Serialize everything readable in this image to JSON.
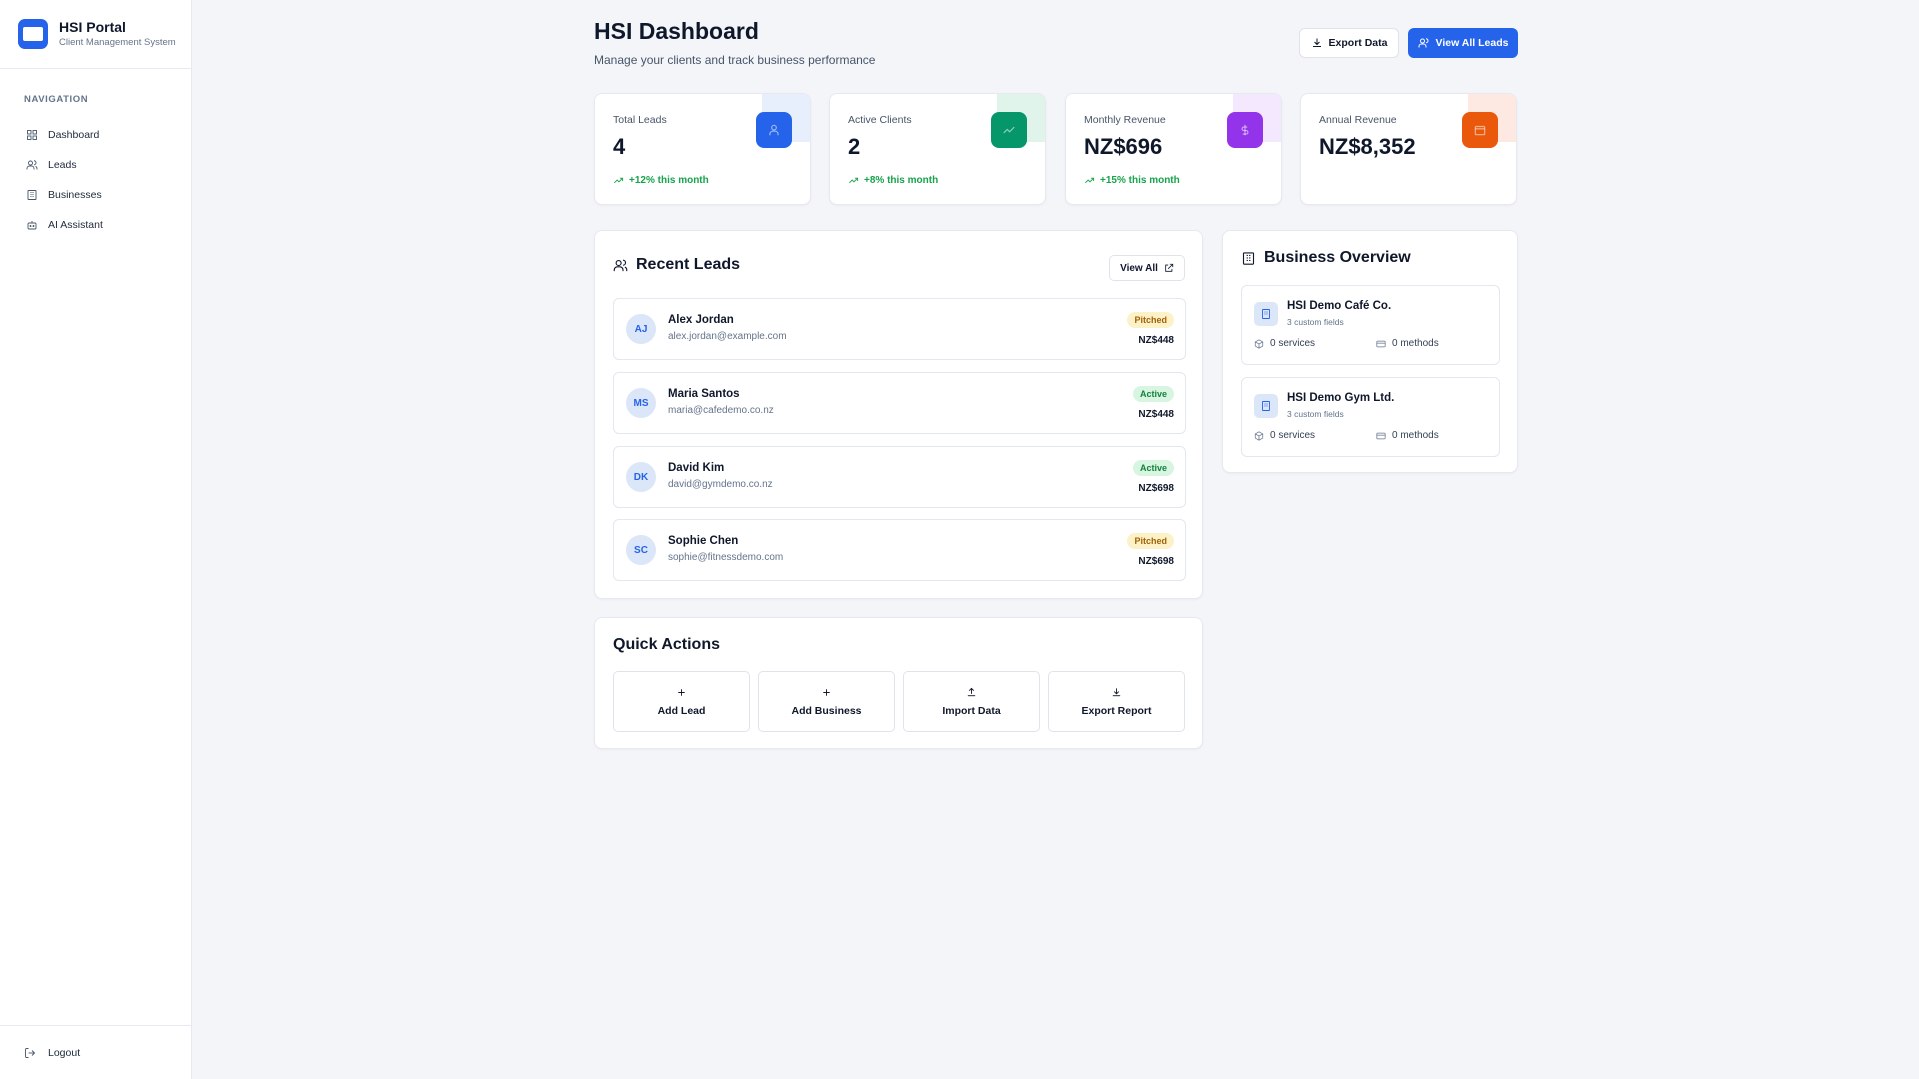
{
  "brand": {
    "title": "HSI Portal",
    "subtitle": "Client Management System"
  },
  "sidebar": {
    "heading": "NAVIGATION",
    "items": [
      {
        "label": "Dashboard",
        "icon": "grid-icon"
      },
      {
        "label": "Leads",
        "icon": "users-icon"
      },
      {
        "label": "Businesses",
        "icon": "building-icon"
      },
      {
        "label": "AI Assistant",
        "icon": "bot-icon"
      }
    ],
    "logout": "Logout"
  },
  "header": {
    "title": "HSI Dashboard",
    "subtitle": "Manage your clients and track business performance",
    "export_label": "Export Data",
    "view_leads_label": "View All Leads"
  },
  "stats": [
    {
      "label": "Total Leads",
      "value": "4",
      "delta": "+12% this month",
      "color": "#2563eb"
    },
    {
      "label": "Active Clients",
      "value": "2",
      "delta": "+8% this month",
      "color": "#059669"
    },
    {
      "label": "Monthly Revenue",
      "value": "NZ$696",
      "delta": "+15% this month",
      "color": "#9333ea"
    },
    {
      "label": "Annual Revenue",
      "value": "NZ$8,352",
      "delta": "",
      "color": "#ea580c"
    }
  ],
  "recent_leads": {
    "title": "Recent Leads",
    "view_all": "View All",
    "items": [
      {
        "initials": "AJ",
        "name": "Alex Jordan",
        "email": "alex.jordan@example.com",
        "status": "Pitched",
        "amount": "NZ$448"
      },
      {
        "initials": "MS",
        "name": "Maria Santos",
        "email": "maria@cafedemo.co.nz",
        "status": "Active",
        "amount": "NZ$448"
      },
      {
        "initials": "DK",
        "name": "David Kim",
        "email": "david@gymdemo.co.nz",
        "status": "Active",
        "amount": "NZ$698"
      },
      {
        "initials": "SC",
        "name": "Sophie Chen",
        "email": "sophie@fitnessdemo.com",
        "status": "Pitched",
        "amount": "NZ$698"
      }
    ]
  },
  "quick_actions": {
    "title": "Quick Actions",
    "items": [
      {
        "label": "Add Lead",
        "icon": "plus-icon"
      },
      {
        "label": "Add Business",
        "icon": "plus-icon"
      },
      {
        "label": "Import Data",
        "icon": "upload-icon"
      },
      {
        "label": "Export Report",
        "icon": "download-icon"
      }
    ]
  },
  "business_overview": {
    "title": "Business Overview",
    "items": [
      {
        "name": "HSI Demo Café Co.",
        "fields": "3 custom fields",
        "services": "0 services",
        "methods": "0 methods"
      },
      {
        "name": "HSI Demo Gym Ltd.",
        "fields": "3 custom fields",
        "services": "0 services",
        "methods": "0 methods"
      }
    ]
  }
}
